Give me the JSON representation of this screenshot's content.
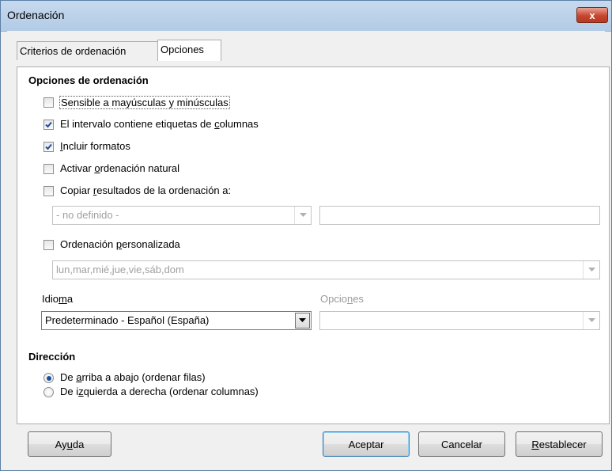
{
  "window": {
    "title": "Ordenación",
    "close_label": "x"
  },
  "tabs": [
    {
      "label": "Criterios de ordenación",
      "active": false
    },
    {
      "label": "Opciones",
      "active": true
    }
  ],
  "sort_options": {
    "heading": "Opciones de ordenación",
    "case_sensitive": {
      "label": "Sensible a mayúsculas y minúsculas",
      "checked": false
    },
    "has_headers": {
      "label_pre": "El intervalo contiene etiquetas de ",
      "label_u": "c",
      "label_post": "olumnas",
      "checked": true
    },
    "include_formats": {
      "label_u": "I",
      "label_post": "ncluir formatos",
      "checked": true
    },
    "natural_sort": {
      "label_pre": "Activar ",
      "label_u": "o",
      "label_post": "rdenación natural",
      "checked": false
    },
    "copy_results": {
      "label_pre": "Copiar ",
      "label_u": "r",
      "label_post": "esultados de la ordenación a:",
      "checked": false
    },
    "copy_target_select": "- no definido -",
    "copy_target_input": "",
    "custom_sort": {
      "label_pre": "Ordenación ",
      "label_u": "p",
      "label_post": "ersonalizada",
      "checked": false
    },
    "custom_sort_list": "lun,mar,mié,jue,vie,sáb,dom",
    "language_label_pre": "Idio",
    "language_label_u": "m",
    "language_label_post": "a",
    "language_value": "Predeterminado - Español (España)",
    "options_label_pre": "Opcio",
    "options_label_u": "n",
    "options_label_post": "es",
    "options_value": ""
  },
  "direction": {
    "heading": "Dirección",
    "top_to_bottom": {
      "label_pre": "De ",
      "label_u": "a",
      "label_post": "rriba a abajo (ordenar filas)",
      "selected": true
    },
    "left_to_right": {
      "label_pre": "De i",
      "label_u": "z",
      "label_post": "quierda a derecha (ordenar columnas)",
      "selected": false
    }
  },
  "buttons": {
    "help": {
      "pre": "Ay",
      "u": "u",
      "post": "da"
    },
    "ok": "Aceptar",
    "cancel": "Cancelar",
    "reset": {
      "u": "R",
      "post": "establecer"
    }
  },
  "colors": {
    "accent": "#1a4fa0",
    "check": "#1f4e9a"
  }
}
